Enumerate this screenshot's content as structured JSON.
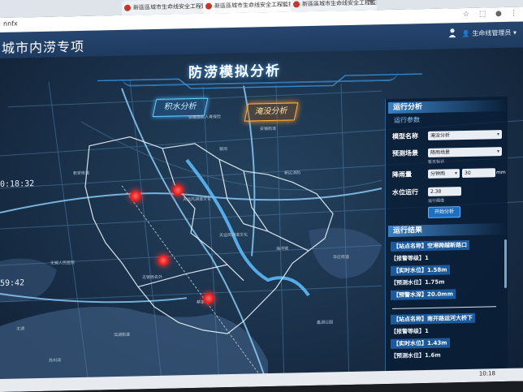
{
  "browser": {
    "tabs": [
      {
        "label": "新區區域市生命线安全工程監控"
      },
      {
        "label": "新區區城市生命线安全工程監控"
      },
      {
        "label": "新區區城市生命线安全工程監控"
      }
    ],
    "address_fragment": "nnfx"
  },
  "app": {
    "title": "城市内涝专项",
    "user": "生命线管理员"
  },
  "map": {
    "title": "防涝模拟分析",
    "accumulation_button": "积水分析",
    "submergence_button": "淹没分析",
    "times": [
      "0:18:32",
      "59:42"
    ],
    "labels": [
      "安徽旗影人寿保险",
      "蔡岗",
      "蔡家嘴",
      "天运风湖道文化",
      "天运风湖道文化",
      "无锡扬名外",
      "无锡人民医院",
      "海洋城",
      "安镇街道",
      "新区消防",
      "滨湖街道",
      "华庄街道",
      "苏州湾",
      "新安街道",
      "太湖",
      "蠡湖公园"
    ]
  },
  "panel": {
    "run_analysis": "运行分析",
    "run_params": "运行参数",
    "scenario_label": "模型名称",
    "scenario_value": "淹没分析",
    "forecast_label": "预测场景",
    "forecast_value": "降雨场景",
    "forecast_tip": "暂无标识",
    "rain_label": "降雨量",
    "rain_unit_value": "分钟雨",
    "rain_amount": "30",
    "rain_unit": "mm",
    "water_label": "水位运行",
    "water_value": "2.38",
    "water_tip": "运行阈值",
    "start_button": "开始分析",
    "results_title": "运行结果",
    "results": [
      {
        "station": "【站点名称】空港跨越新路口",
        "alarm": "【报警等级】1",
        "actual": "【实时水位】1.58m",
        "forecast": "【预测水位】1.75m",
        "warning": "【预警水深】20.0mm"
      },
      {
        "station": "【站点名称】南开路运河大桥下",
        "alarm": "【报警等级】1",
        "actual": "【实时水位】1.43m",
        "forecast": "【预测水位】1.6m"
      }
    ]
  },
  "taskbar": {
    "clock": "10:18"
  }
}
